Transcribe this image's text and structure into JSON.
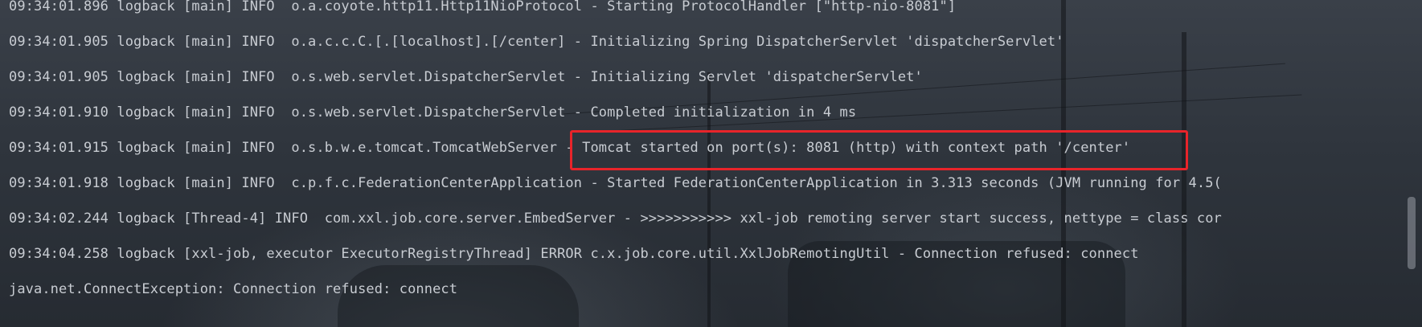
{
  "console": {
    "lines": [
      "09:34:01.896 logback [main] INFO  o.a.coyote.http11.Http11NioProtocol - Starting ProtocolHandler [\"http-nio-8081\"]",
      "09:34:01.905 logback [main] INFO  o.a.c.c.C.[.[localhost].[/center] - Initializing Spring DispatcherServlet 'dispatcherServlet'",
      "09:34:01.905 logback [main] INFO  o.s.web.servlet.DispatcherServlet - Initializing Servlet 'dispatcherServlet'",
      "09:34:01.910 logback [main] INFO  o.s.web.servlet.DispatcherServlet - Completed initialization in 4 ms",
      "09:34:01.915 logback [main] INFO  o.s.b.w.e.tomcat.TomcatWebServer - Tomcat started on port(s): 8081 (http) with context path '/center'",
      "09:34:01.918 logback [main] INFO  c.p.f.c.FederationCenterApplication - Started FederationCenterApplication in 3.313 seconds (JVM running for 4.5(",
      "09:34:02.244 logback [Thread-4] INFO  com.xxl.job.core.server.EmbedServer - >>>>>>>>>>> xxl-job remoting server start success, nettype = class cor",
      "09:34:04.258 logback [xxl-job, executor ExecutorRegistryThread] ERROR c.x.job.core.util.XxlJobRemotingUtil - Connection refused: connect",
      "java.net.ConnectException: Connection refused: connect"
    ]
  },
  "annotation": {
    "color": "#e8242a"
  },
  "colors": {
    "text": "#c8ccd2",
    "background": "#2b3038"
  }
}
